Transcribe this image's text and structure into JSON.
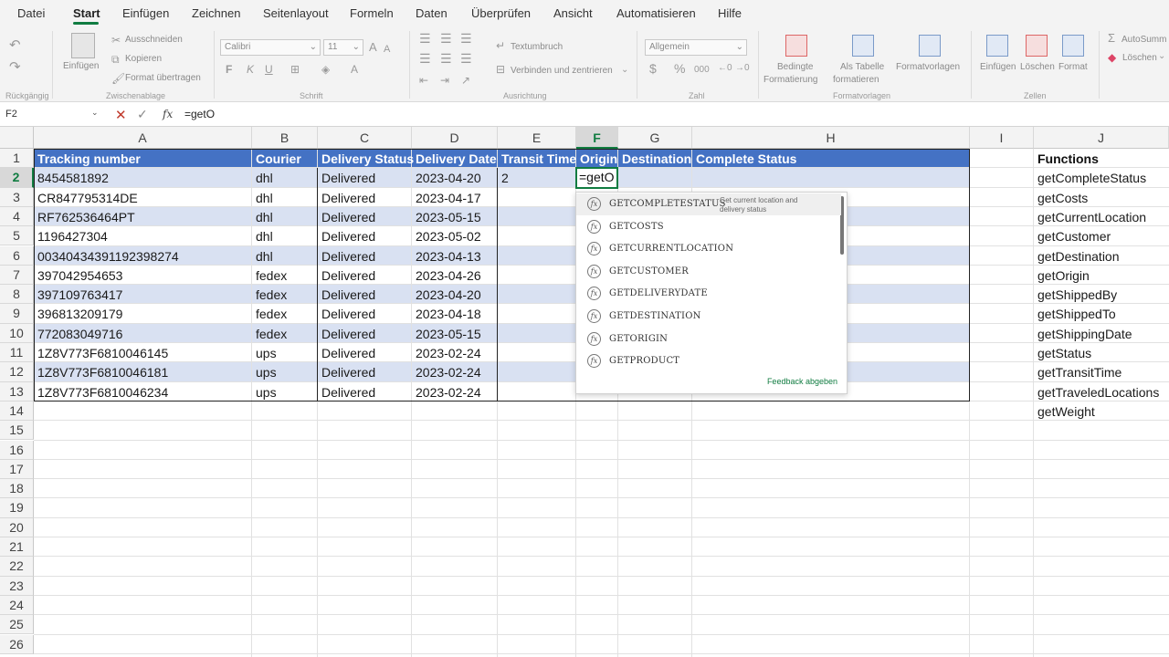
{
  "ribbon_tabs": [
    "Datei",
    "Start",
    "Einfügen",
    "Zeichnen",
    "Seitenlayout",
    "Formeln",
    "Daten",
    "Überprüfen",
    "Ansicht",
    "Automatisieren",
    "Hilfe"
  ],
  "ribbon": {
    "undo_group": "Rückgängig",
    "paste": "Einfügen",
    "cut": "Ausschneiden",
    "copy": "Kopieren",
    "format_painter": "Format übertragen",
    "clipboard_group": "Zwischenablage",
    "font_name": "Calibri",
    "font_size": "11",
    "bold": "F",
    "italic": "K",
    "underline": "U",
    "font_group": "Schrift",
    "wrap_text": "Textumbruch",
    "merge_center": "Verbinden und zentrieren",
    "alignment_group": "Ausrichtung",
    "number_format": "Allgemein",
    "number_group": "Zahl",
    "cond_format_1": "Bedingte",
    "cond_format_2": "Formatierung",
    "as_table_1": "Als Tabelle",
    "as_table_2": "formatieren",
    "cell_styles": "Formatvorlagen",
    "styles_group": "Formatvorlagen",
    "insert": "Einfügen",
    "delete": "Löschen",
    "format": "Format",
    "cells_group": "Zellen",
    "autosum": "AutoSumm",
    "clear": "Löschen"
  },
  "formula_bar": {
    "name_box": "F2",
    "fx": "fx",
    "formula": "=getO"
  },
  "columns": [
    "A",
    "B",
    "C",
    "D",
    "E",
    "F",
    "G",
    "H",
    "I",
    "J"
  ],
  "rows": [
    "1",
    "2",
    "3",
    "4",
    "5",
    "6",
    "7",
    "8",
    "9",
    "10",
    "11",
    "12",
    "13",
    "14",
    "15",
    "16",
    "17",
    "18",
    "19",
    "20",
    "21",
    "22",
    "23",
    "24",
    "25",
    "26"
  ],
  "table_headers": [
    "Tracking number",
    "Courier",
    "Delivery Status",
    "Delivery Date",
    "Transit Time",
    "Origin",
    "Destination",
    "Complete Status"
  ],
  "table_rows": [
    [
      "8454581892",
      "dhl",
      "Delivered",
      "2023-04-20",
      "2"
    ],
    [
      "CR847795314DE",
      "dhl",
      "Delivered",
      "2023-04-17",
      ""
    ],
    [
      "RF762536464PT",
      "dhl",
      "Delivered",
      "2023-05-15",
      ""
    ],
    [
      "1196427304",
      "dhl",
      "Delivered",
      "2023-05-02",
      ""
    ],
    [
      "00340434391192398274",
      "dhl",
      "Delivered",
      "2023-04-13",
      ""
    ],
    [
      "397042954653",
      "fedex",
      "Delivered",
      "2023-04-26",
      ""
    ],
    [
      "397109763417",
      "fedex",
      "Delivered",
      "2023-04-20",
      ""
    ],
    [
      "396813209179",
      "fedex",
      "Delivered",
      "2023-04-18",
      ""
    ],
    [
      "772083049716",
      "fedex",
      "Delivered",
      "2023-05-15",
      ""
    ],
    [
      "1Z8V773F6810046145",
      "ups",
      "Delivered",
      "2023-02-24",
      ""
    ],
    [
      "1Z8V773F6810046181",
      "ups",
      "Delivered",
      "2023-02-24",
      ""
    ],
    [
      "1Z8V773F6810046234",
      "ups",
      "Delivered",
      "2023-02-24",
      ""
    ]
  ],
  "active_cell_value": "=getO",
  "functions_header": "Functions",
  "functions": [
    "getCompleteStatus",
    "getCosts",
    "getCurrentLocation",
    "getCustomer",
    "getDestination",
    "getOrigin",
    "getShippedBy",
    "getShippedTo",
    "getShippingDate",
    "getStatus",
    "getTransitTime",
    "getTraveledLocations",
    "getWeight"
  ],
  "autocomplete": {
    "items": [
      "GETCOMPLETESTATUS",
      "GETCOSTS",
      "GETCURRENTLOCATION",
      "GETCUSTOMER",
      "GETDELIVERYDATE",
      "GETDESTINATION",
      "GETORIGIN",
      "GETPRODUCT"
    ],
    "tooltip": "Get current location and delivery status",
    "feedback": "Feedback abgeben"
  },
  "colors": {
    "accent_green": "#107c41",
    "table_header_blue": "#4472c4",
    "band_light": "#d9e1f2"
  }
}
